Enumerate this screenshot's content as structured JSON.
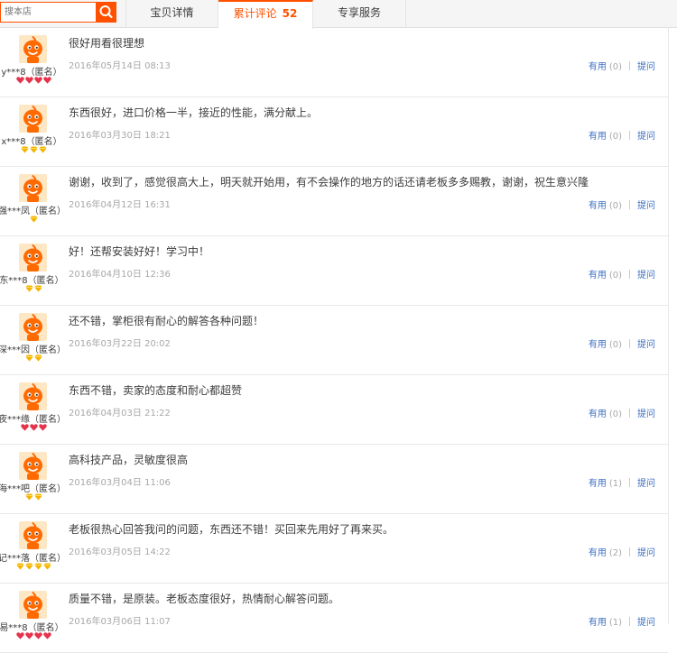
{
  "search": {
    "placeholder": "搜本店"
  },
  "tabs": {
    "detail": "宝贝详情",
    "reviews": "累计评论",
    "review_count": "52",
    "service": "专享服务"
  },
  "actions": {
    "useful": "有用",
    "ask": "提问"
  },
  "colors": {
    "accent": "#ff5000",
    "link": "#3d6fc1",
    "muted": "#a8a8a8",
    "heart": "#e5334b",
    "diamond": "#f5b400"
  },
  "reviews": [
    {
      "user": "y***8（匿名）",
      "rank": {
        "type": "heart",
        "count": 4
      },
      "content": "很好用看很理想",
      "date": "2016年05月14日 08:13",
      "useful": "(0)"
    },
    {
      "user": "x***8（匿名）",
      "rank": {
        "type": "diamond",
        "count": 3
      },
      "content": "东西很好，进口价格一半，接近的性能，满分献上。",
      "date": "2016年03月30日 18:21",
      "useful": "(0)"
    },
    {
      "user": "强***凤（匿名）",
      "rank": {
        "type": "diamond",
        "count": 1
      },
      "content": "谢谢，收到了，感觉很高大上，明天就开始用，有不会操作的地方的话还请老板多多赐教，谢谢，祝生意兴隆",
      "date": "2016年04月12日 16:31",
      "useful": "(0)"
    },
    {
      "user": "东***8（匿名）",
      "rank": {
        "type": "diamond",
        "count": 2
      },
      "content": "好！还帮安装好好！学习中！",
      "date": "2016年04月10日 12:36",
      "useful": "(0)"
    },
    {
      "user": "深***因（匿名）",
      "rank": {
        "type": "diamond",
        "count": 2
      },
      "content": "还不错，掌柜很有耐心的解答各种问题！",
      "date": "2016年03月22日 20:02",
      "useful": "(0)"
    },
    {
      "user": "夜***缘（匿名）",
      "rank": {
        "type": "heart",
        "count": 3
      },
      "content": "东西不错，卖家的态度和耐心都超赞",
      "date": "2016年04月03日 21:22",
      "useful": "(0)"
    },
    {
      "user": "海***吧（匿名）",
      "rank": {
        "type": "diamond",
        "count": 2
      },
      "content": "高科技产品，灵敏度很高",
      "date": "2016年03月04日 11:06",
      "useful": "(1)"
    },
    {
      "user": "记***落（匿名）",
      "rank": {
        "type": "diamond",
        "count": 4
      },
      "content": "老板很热心回答我问的问题，东西还不错！买回来先用好了再来买。",
      "date": "2016年03月05日 14:22",
      "useful": "(2)"
    },
    {
      "user": "易***8（匿名）",
      "rank": {
        "type": "heart",
        "count": 4
      },
      "content": "质量不错，是原装。老板态度很好，热情耐心解答问题。",
      "date": "2016年03月06日 11:07",
      "useful": "(1)"
    }
  ]
}
